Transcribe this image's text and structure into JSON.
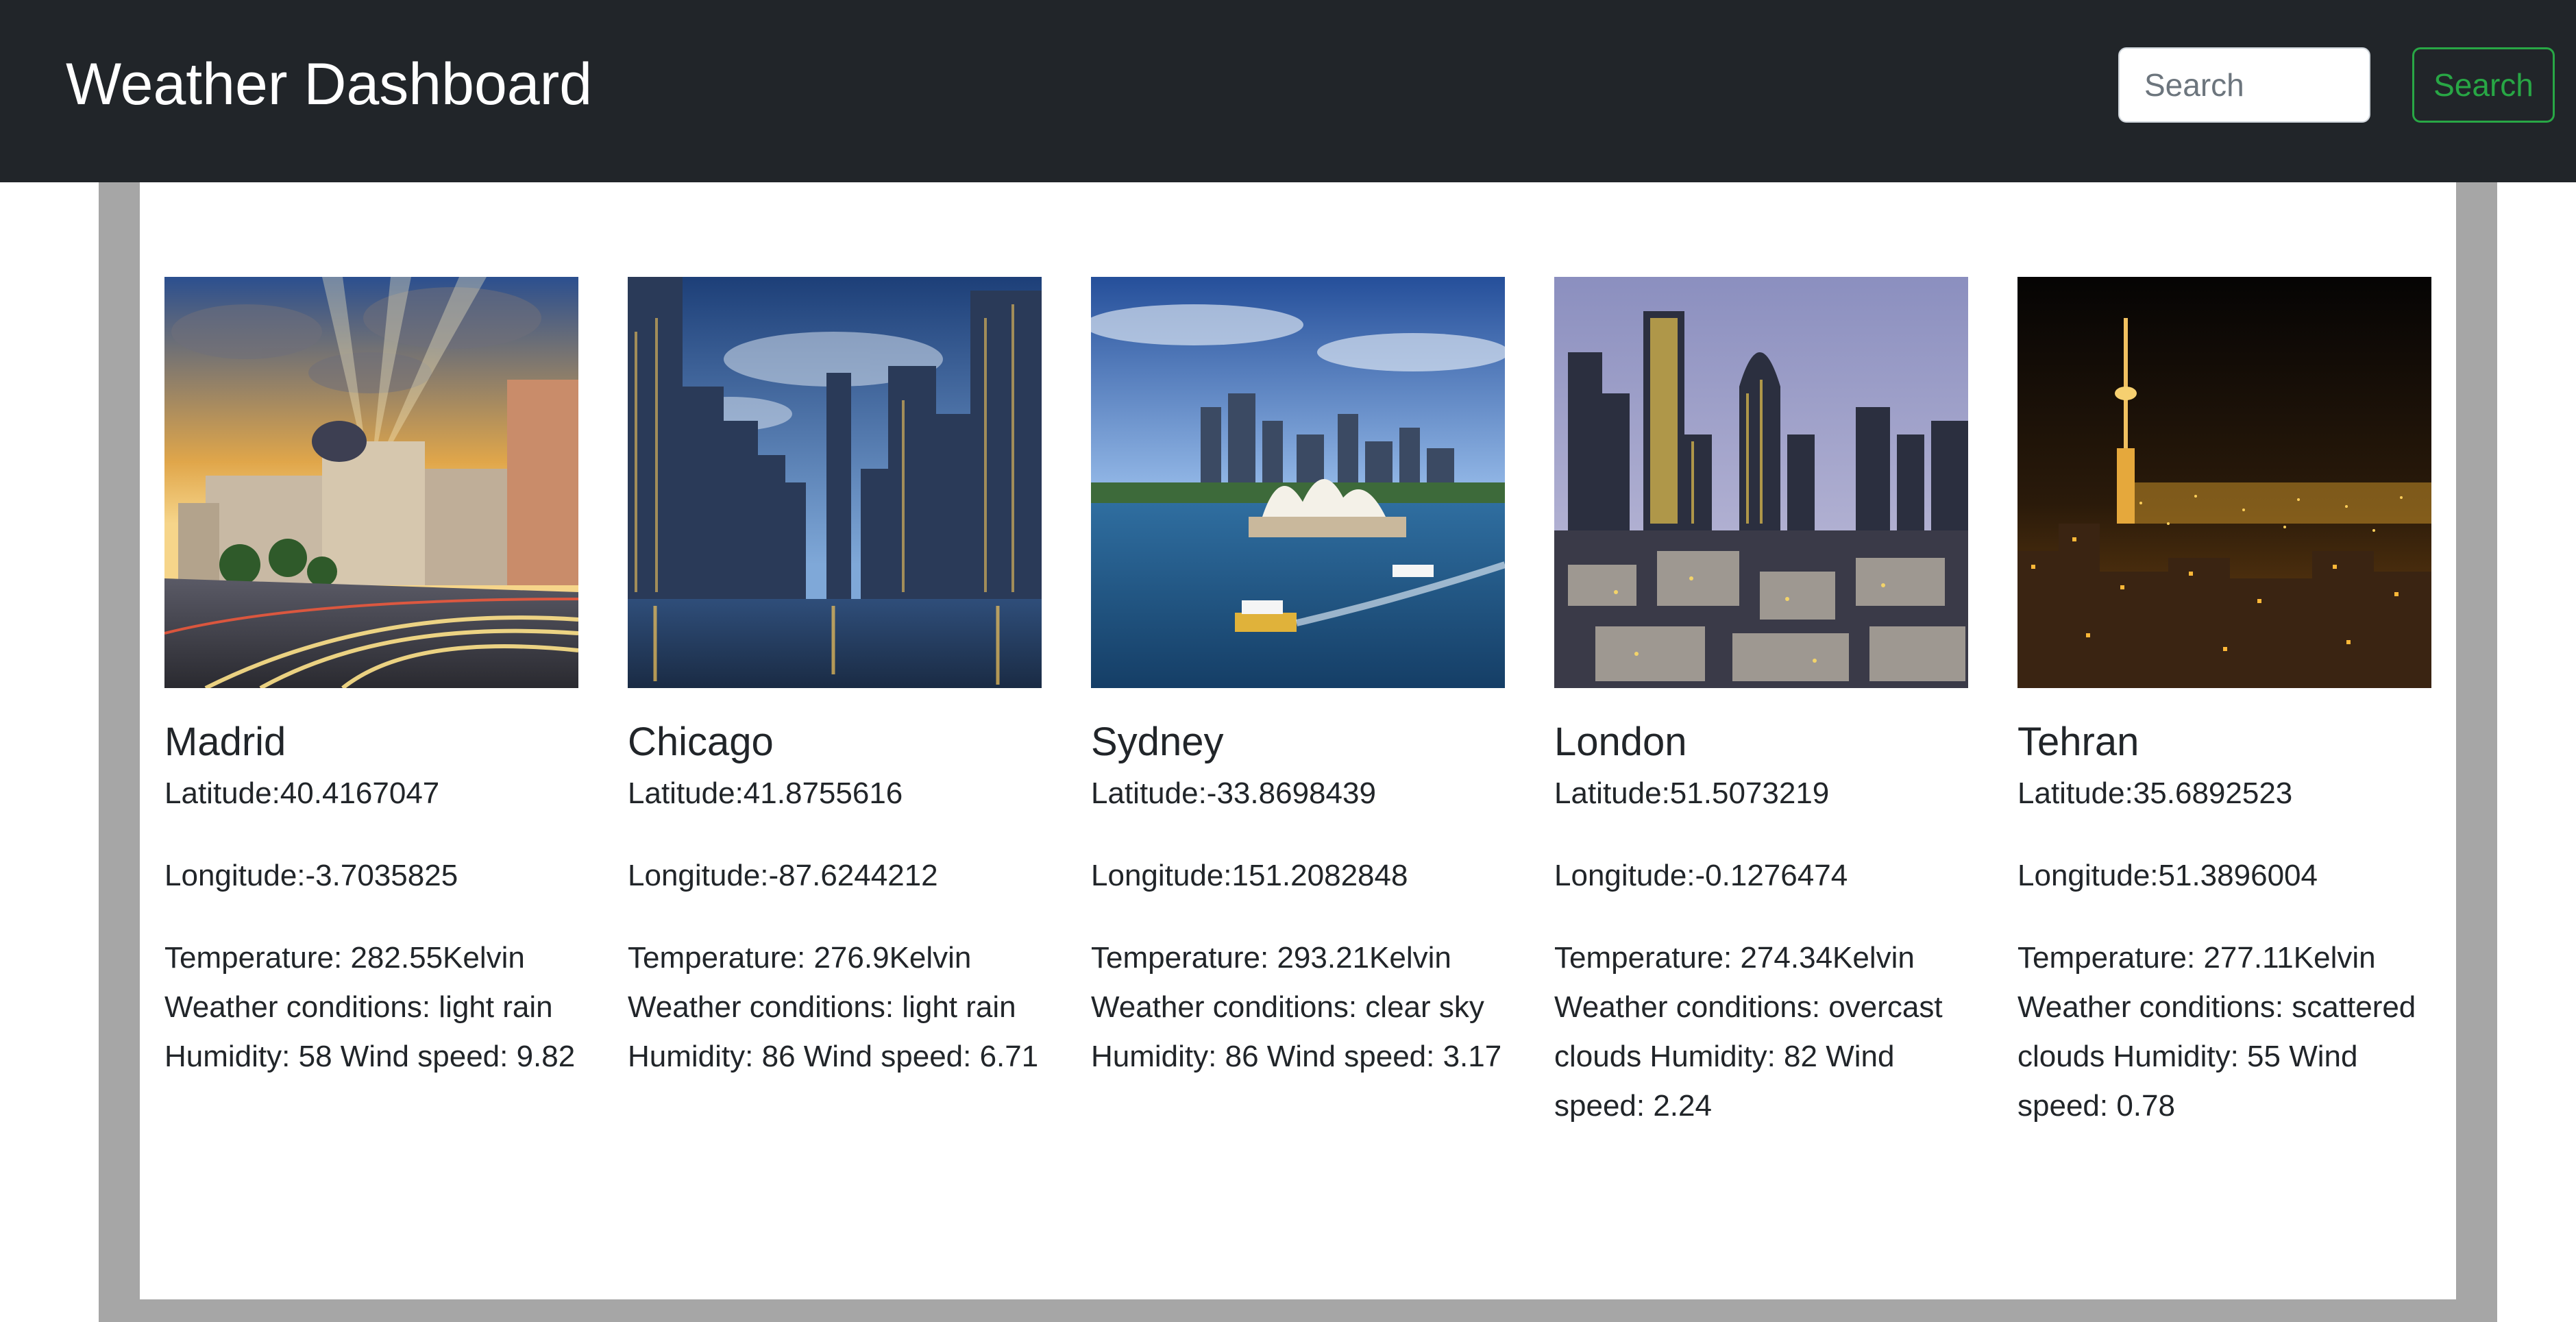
{
  "header": {
    "title": "Weather Dashboard",
    "search_placeholder": "Search",
    "search_button": "Search"
  },
  "colors": {
    "navbar": "#212529",
    "frame": "#a6a6a6",
    "search_button_accent": "#28a745"
  },
  "cities": [
    {
      "name": "Madrid",
      "latitude": "Latitude:40.4167047",
      "longitude": "Longitude:-3.7035825",
      "temperature": "Temperature: 282.55Kelvin",
      "conditions": "Weather conditions: light rain",
      "humidity": "Humidity: 58",
      "wind": "Wind speed: 9.82",
      "image": "madrid-street-sunset-photo"
    },
    {
      "name": "Chicago",
      "latitude": "Latitude:41.8755616",
      "longitude": "Longitude:-87.6244212",
      "temperature": "Temperature: 276.9Kelvin",
      "conditions": "Weather conditions: light rain",
      "humidity": "Humidity: 86",
      "wind": "Wind speed: 6.71",
      "image": "chicago-river-skyline-photo"
    },
    {
      "name": "Sydney",
      "latitude": "Latitude:-33.8698439",
      "longitude": "Longitude:151.2082848",
      "temperature": "Temperature: 293.21Kelvin",
      "conditions": "Weather conditions: clear sky",
      "humidity": "Humidity: 86",
      "wind": "Wind speed: 3.17",
      "image": "sydney-opera-house-photo"
    },
    {
      "name": "London",
      "latitude": "Latitude:51.5073219",
      "longitude": "Longitude:-0.1276474",
      "temperature": "Temperature: 274.34Kelvin",
      "conditions": "Weather conditions: overcast clouds",
      "humidity": "Humidity: 82",
      "wind": "Wind speed: 2.24",
      "image": "london-city-skyline-photo"
    },
    {
      "name": "Tehran",
      "latitude": "Latitude:35.6892523",
      "longitude": "Longitude:51.3896004",
      "temperature": "Temperature: 277.11Kelvin",
      "conditions": "Weather conditions: scattered clouds",
      "humidity": "Humidity: 55",
      "wind": "Wind speed: 0.78",
      "image": "tehran-night-tower-photo"
    }
  ]
}
